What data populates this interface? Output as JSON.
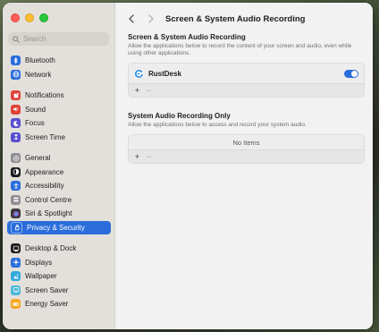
{
  "sidebar": {
    "search_placeholder": "Search",
    "items": [
      {
        "label": "Bluetooth",
        "icon": "bluetooth-icon",
        "color": "#2a6ddb"
      },
      {
        "label": "Network",
        "icon": "globe-icon",
        "color": "#2a6ddb"
      },
      {
        "label": "Notifications",
        "icon": "bell-icon",
        "color": "#e0413a"
      },
      {
        "label": "Sound",
        "icon": "speaker-icon",
        "color": "#e0413a"
      },
      {
        "label": "Focus",
        "icon": "moon-icon",
        "color": "#5a4fcf"
      },
      {
        "label": "Screen Time",
        "icon": "hourglass-icon",
        "color": "#5a4fcf"
      },
      {
        "label": "General",
        "icon": "gear-icon",
        "color": "#8e8e93"
      },
      {
        "label": "Appearance",
        "icon": "appearance-icon",
        "color": "#1d1d1f"
      },
      {
        "label": "Accessibility",
        "icon": "accessibility-icon",
        "color": "#2a6ddb"
      },
      {
        "label": "Control Centre",
        "icon": "control-centre-icon",
        "color": "#8e8e93"
      },
      {
        "label": "Siri & Spotlight",
        "icon": "siri-icon",
        "color": "#3a3a3c"
      },
      {
        "label": "Privacy & Security",
        "icon": "hand-icon",
        "color": "#2a6ddb"
      },
      {
        "label": "Desktop & Dock",
        "icon": "dock-icon",
        "color": "#1d1d1f"
      },
      {
        "label": "Displays",
        "icon": "sun-icon",
        "color": "#2a6ddb"
      },
      {
        "label": "Wallpaper",
        "icon": "wallpaper-icon",
        "color": "#34aadc"
      },
      {
        "label": "Screen Saver",
        "icon": "screen-saver-icon",
        "color": "#4cb8d8"
      },
      {
        "label": "Energy Saver",
        "icon": "battery-icon",
        "color": "#f5a623"
      }
    ]
  },
  "header": {
    "title": "Screen & System Audio Recording"
  },
  "section1": {
    "title": "Screen & System Audio Recording",
    "description": "Allow the applications below to record the content of your screen and audio, even while using other applications.",
    "apps": [
      {
        "name": "RustDesk",
        "enabled": true,
        "icon": "rustdesk-icon"
      }
    ]
  },
  "section2": {
    "title": "System Audio Recording Only",
    "description": "Allow the applications below to access and record your system audio.",
    "empty_text": "No Items"
  },
  "controls": {
    "add": "+",
    "remove": "−"
  },
  "colors": {
    "accent": "#2a6ddb"
  }
}
